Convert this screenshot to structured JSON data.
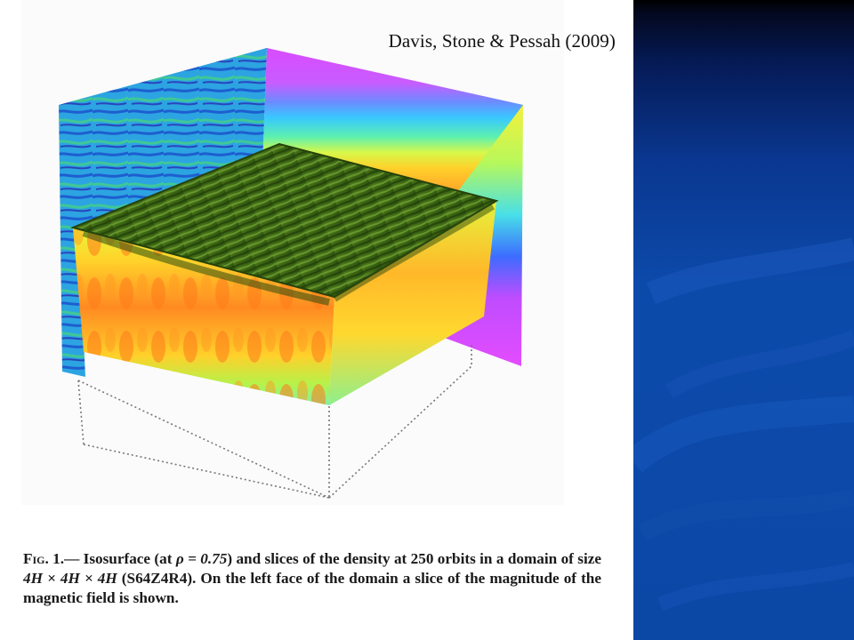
{
  "citation": "Davis, Stone & Pessah (2009)",
  "caption": {
    "label": "Fig. 1.—",
    "parts": [
      "Isosurface (at ",
      "ρ = 0.75",
      ") and slices of the density at 250 orbits in a domain of size ",
      "4H × 4H × 4H",
      " (S64Z4R4). On the left face of the domain a slice of the magnitude of the magnetic field is shown."
    ]
  },
  "colors": {
    "band_dark": "#03081e",
    "band_blue": "#0c4aaa",
    "magenta": "#d24bff",
    "isosurface_green": "#3f6b14",
    "density_yellow": "#f3f03a",
    "density_orange": "#ff7a1a",
    "field_cyan": "#2fc6e8"
  }
}
